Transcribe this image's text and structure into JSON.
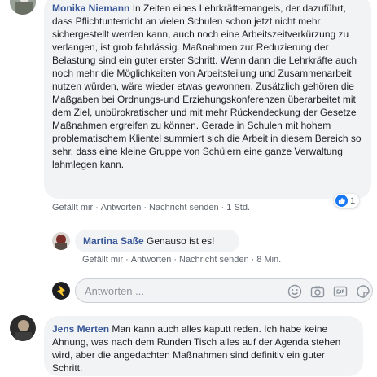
{
  "comment1": {
    "author": "Monika Niemann",
    "text": "In Zeiten eines Lehrkräftemangels, der dazuführt, dass Pflichtunterricht an vielen Schulen schon jetzt nicht mehr sichergestellt werden kann, auch noch eine Arbeitszeitverkürzung zu verlangen, ist grob fahrlässig. Maßnahmen zur Reduzierung der Belastung sind ein guter erster Schritt. Wenn dann die Lehrkräfte auch noch mehr die Möglichkeiten von Arbeitsteilung und Zusammenarbeit nutzen würden, wäre wieder etwas gewonnen. Zusätzlich gehören die Maßgaben bei Ordnungs-und Erziehungskonferenzen überarbeitet mit dem Ziel, unbürokratischer und mit mehr Rückendeckung der Gesetze Maßnahmen ergreifen zu können. Gerade in Schulen mit hohem problematischem Klientel summiert sich die Arbeit in diesem Bereich so sehr, dass eine kleine Gruppe von Schülern eine ganze Verwaltung lahmlegen kann.",
    "like_label": "Gefällt mir",
    "reply_label": "Antworten",
    "send_label": "Nachricht senden",
    "time": "1 Std.",
    "reaction_count": "1"
  },
  "reply1": {
    "author": "Martina Saße",
    "text": "Genauso ist es!",
    "like_label": "Gefällt mir",
    "reply_label": "Antworten",
    "send_label": "Nachricht senden",
    "time": "8 Min."
  },
  "composer": {
    "placeholder": "Antworten ..."
  },
  "comment2": {
    "author": "Jens Merten",
    "text": "Man kann auch alles kaputt reden. Ich habe keine Ahnung, was nach dem Runden Tisch alles auf der Agenda stehen wird, aber die angedachten Maßnahmen sind definitiv ein guter Schritt."
  },
  "colors": {
    "link_blue": "#385898",
    "like_blue": "#1877f2",
    "bubble_gray": "#f2f3f5",
    "meta_gray": "#606770"
  }
}
